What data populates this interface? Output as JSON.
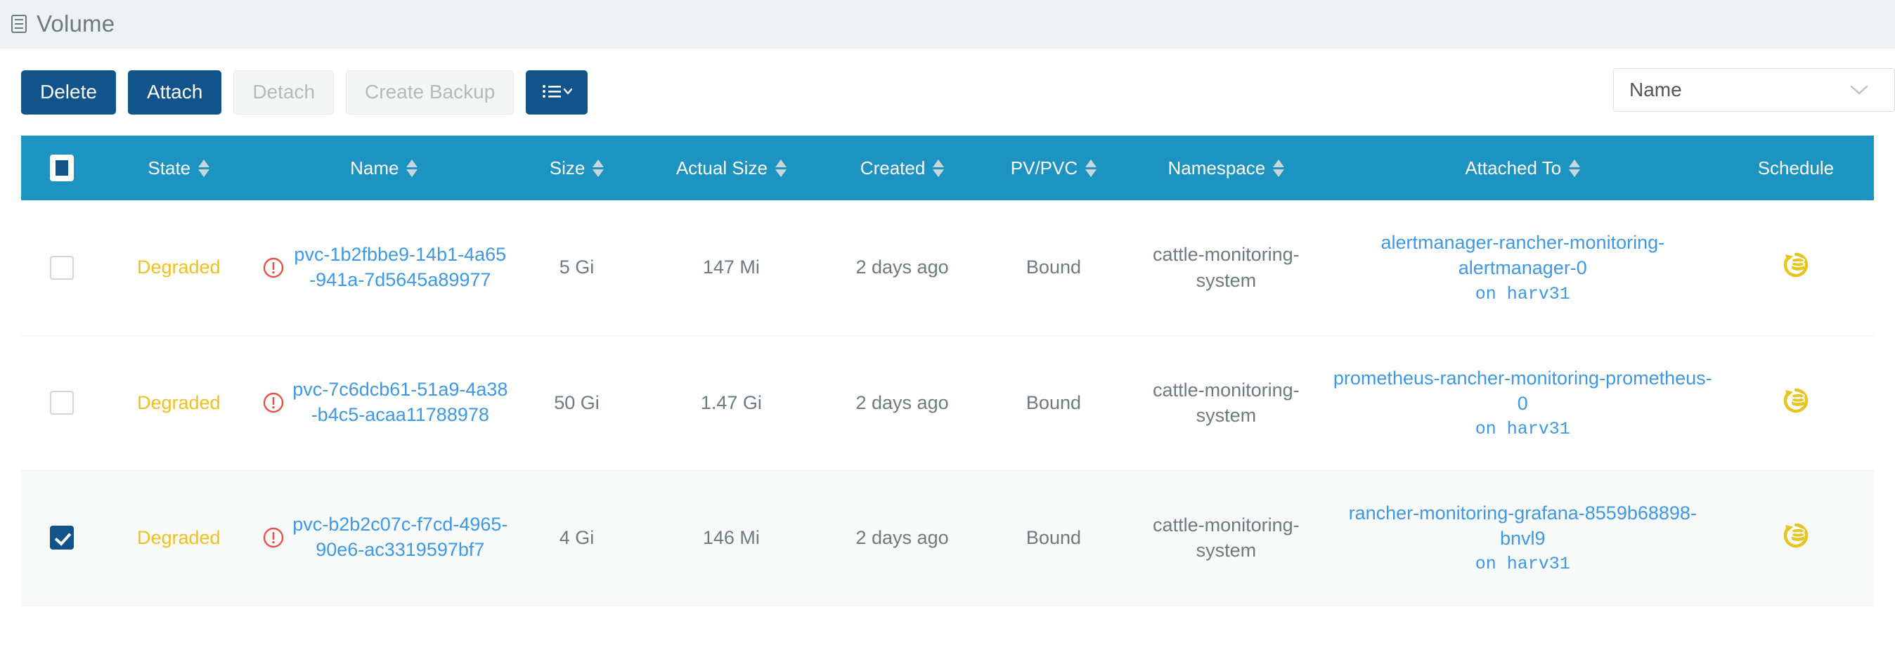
{
  "header": {
    "title": "Volume",
    "icon": "volume-stack-icon"
  },
  "toolbar": {
    "delete_label": "Delete",
    "attach_label": "Attach",
    "detach_label": "Detach",
    "create_backup_label": "Create Backup",
    "list_menu_icon": "list-chevron-down-icon",
    "filter": {
      "selected": "Name",
      "chevron_icon": "chevron-down-icon"
    }
  },
  "colors": {
    "primary_button": "#11548b",
    "table_header": "#1d93c2",
    "link": "#3d98e8",
    "warning_state": "#f0c020",
    "error_icon": "#e8514b",
    "schedule_icon": "#e8c420",
    "title_bar": "#eef2f3"
  },
  "table": {
    "columns": [
      {
        "key": "checkbox",
        "label": "",
        "sortable": false,
        "icon": "select-all-checkbox"
      },
      {
        "key": "state",
        "label": "State",
        "sortable": true
      },
      {
        "key": "name",
        "label": "Name",
        "sortable": true
      },
      {
        "key": "size",
        "label": "Size",
        "sortable": true
      },
      {
        "key": "actual_size",
        "label": "Actual Size",
        "sortable": true
      },
      {
        "key": "created",
        "label": "Created",
        "sortable": true
      },
      {
        "key": "pvpvc",
        "label": "PV/PVC",
        "sortable": true
      },
      {
        "key": "namespace",
        "label": "Namespace",
        "sortable": true
      },
      {
        "key": "attached_to",
        "label": "Attached To",
        "sortable": true
      },
      {
        "key": "schedule",
        "label": "Schedule",
        "sortable": false
      }
    ],
    "rows": [
      {
        "selected": false,
        "state": "Degraded",
        "has_error_icon": true,
        "name": "pvc-1b2fbbe9-14b1-4a65-941a-7d5645a89977",
        "size": "5 Gi",
        "actual_size": "147 Mi",
        "created": "2 days ago",
        "pvpvc": "Bound",
        "namespace": "cattle-monitoring-system",
        "attached_to": "alertmanager-rancher-monitoring-alertmanager-0",
        "attached_on_prefix": "on",
        "attached_node": "harv31",
        "schedule_icon": "backup-schedule-icon"
      },
      {
        "selected": false,
        "state": "Degraded",
        "has_error_icon": true,
        "name": "pvc-7c6dcb61-51a9-4a38-b4c5-acaa11788978",
        "size": "50 Gi",
        "actual_size": "1.47 Gi",
        "created": "2 days ago",
        "pvpvc": "Bound",
        "namespace": "cattle-monitoring-system",
        "attached_to": "prometheus-rancher-monitoring-prometheus-0",
        "attached_on_prefix": "on",
        "attached_node": "harv31",
        "schedule_icon": "backup-schedule-icon"
      },
      {
        "selected": true,
        "state": "Degraded",
        "has_error_icon": true,
        "name": "pvc-b2b2c07c-f7cd-4965-90e6-ac3319597bf7",
        "size": "4 Gi",
        "actual_size": "146 Mi",
        "created": "2 days ago",
        "pvpvc": "Bound",
        "namespace": "cattle-monitoring-system",
        "attached_to": "rancher-monitoring-grafana-8559b68898-bnvl9",
        "attached_on_prefix": "on",
        "attached_node": "harv31",
        "schedule_icon": "backup-schedule-icon"
      }
    ]
  }
}
